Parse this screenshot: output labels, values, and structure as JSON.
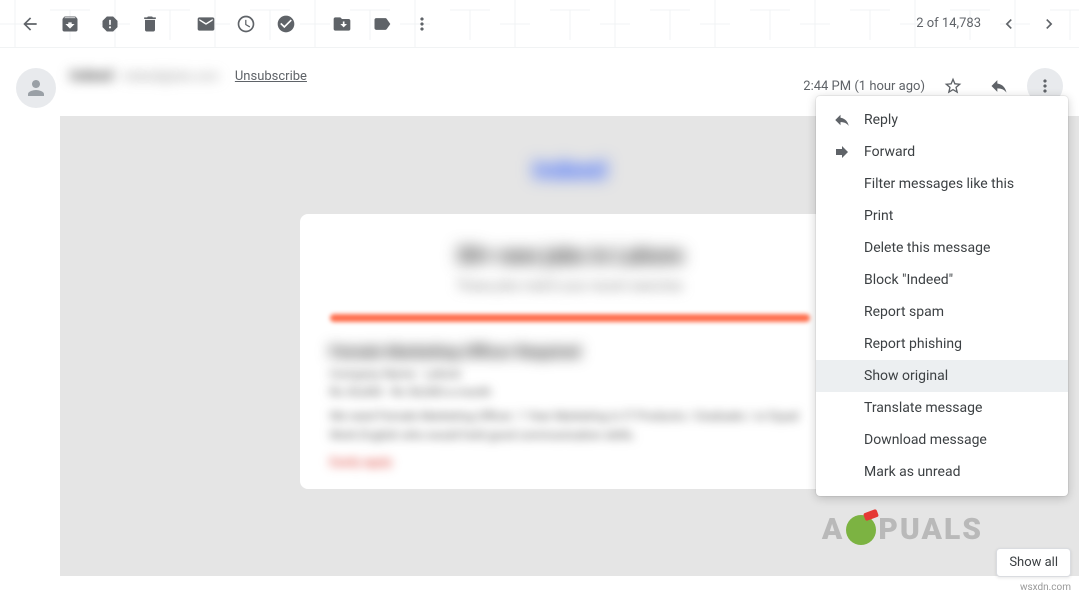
{
  "toolbar": {
    "count": "2 of 14,783"
  },
  "header": {
    "sender_name": "Indeed",
    "sender_email": "indeed@jobs.com",
    "unsubscribe": "Unsubscribe",
    "time": "2:44 PM (1 hour ago)"
  },
  "body": {
    "brand": "Indeed",
    "title": "30+ new jobs in Lahore",
    "subtitle": "These jobs match your recent searches",
    "job_title": "Female Marketing Officer Required",
    "job_meta1": "Company Name · Lahore",
    "job_meta2": "Rs 35,000 - Rs 50,000 a month",
    "job_desc": "We need Female Marketing Officer. 1 Year Marketing in IT Products / Graduate / or Equal Work English who would hold good communication skills.",
    "job_link": "Easily apply"
  },
  "menu": {
    "items": [
      {
        "label": "Reply",
        "icon": "reply"
      },
      {
        "label": "Forward",
        "icon": "forward"
      },
      {
        "label": "Filter messages like this",
        "icon": ""
      },
      {
        "label": "Print",
        "icon": ""
      },
      {
        "label": "Delete this message",
        "icon": ""
      },
      {
        "label": "Block \"Indeed\"",
        "icon": ""
      },
      {
        "label": "Report spam",
        "icon": ""
      },
      {
        "label": "Report phishing",
        "icon": ""
      },
      {
        "label": "Show original",
        "icon": "",
        "highlighted": true
      },
      {
        "label": "Translate message",
        "icon": ""
      },
      {
        "label": "Download message",
        "icon": ""
      },
      {
        "label": "Mark as unread",
        "icon": ""
      }
    ]
  },
  "footer": {
    "show_all": "Show all",
    "srcurl": "wsxdn.com"
  },
  "watermark": {
    "a": "A",
    "rest": "PUALS"
  }
}
